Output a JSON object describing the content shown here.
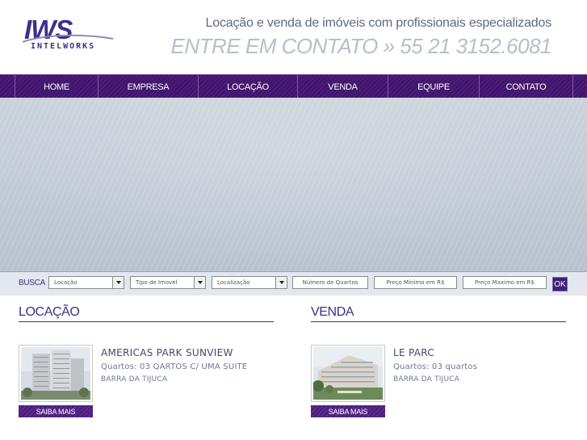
{
  "header": {
    "logo_text": "IWS",
    "logo_subtext": "INTELWORKS",
    "tagline": "Locação e venda de imóveis com profissionais especializados",
    "contact": "ENTRE EM CONTATO » 55 21 3152.6081"
  },
  "nav": {
    "items": [
      {
        "label": "HOME"
      },
      {
        "label": "EMPRESA"
      },
      {
        "label": "LOCAÇÃO"
      },
      {
        "label": "VENDA"
      },
      {
        "label": "EQUIPE"
      },
      {
        "label": "CONTATO"
      }
    ]
  },
  "search": {
    "label": "BUSCA",
    "type_select": "Locação",
    "property_select": "Tipo de Imovel",
    "location_select": "Localização",
    "rooms_placeholder": "Número de Quartos",
    "min_price_placeholder": "Preço Mínimo em R$",
    "max_price_placeholder": "Preço Maximo em R$",
    "ok_label": "OK"
  },
  "locacao": {
    "title": "LOCAÇÃO",
    "listing": {
      "name": "AMERICAS PARK SUNVIEW",
      "rooms": "Quartos: 03 QARTOS C/ UMA SUITE",
      "area": "BARRA DA TIJUCA",
      "button": "SAIBA MAIS"
    }
  },
  "venda": {
    "title": "VENDA",
    "listing": {
      "name": "LE PARC",
      "rooms": "Quartos: 03 quartos",
      "area": "BARRA DA TIJUCA",
      "button": "SAIBA MAIS"
    }
  },
  "colors": {
    "brand_purple": "#3b2f8a",
    "nav_purple": "#4b1d7a"
  }
}
